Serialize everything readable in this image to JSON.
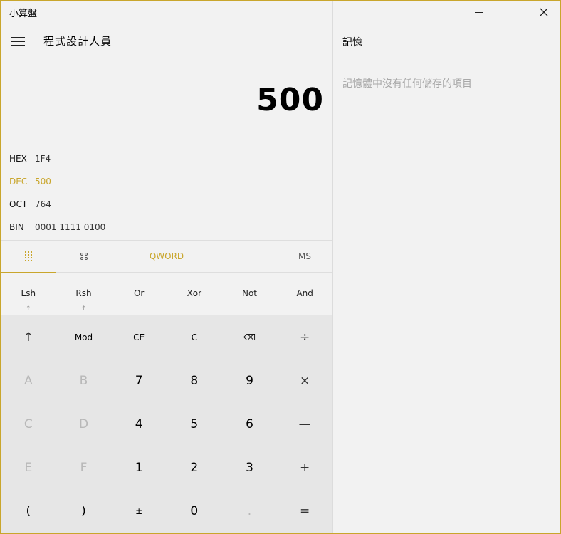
{
  "window": {
    "title": "小算盤",
    "accent": "#c9a62c"
  },
  "header": {
    "mode_title": "程式設計人員"
  },
  "display": {
    "value": "500"
  },
  "radix": [
    {
      "label": "HEX",
      "value": "1F4",
      "active": false
    },
    {
      "label": "DEC",
      "value": "500",
      "active": true
    },
    {
      "label": "OCT",
      "value": "764",
      "active": false
    },
    {
      "label": "BIN",
      "value": "0001 1111 0100",
      "active": false
    }
  ],
  "tabs": {
    "keypad_icon": "full-keypad-icon",
    "bits_icon": "bit-toggling-keypad-icon",
    "word_size": "QWORD",
    "memory_store": "MS"
  },
  "ops": [
    {
      "label": "Lsh",
      "sub": "↑"
    },
    {
      "label": "Rsh",
      "sub": "↑"
    },
    {
      "label": "Or",
      "sub": ""
    },
    {
      "label": "Xor",
      "sub": ""
    },
    {
      "label": "Not",
      "sub": ""
    },
    {
      "label": "And",
      "sub": ""
    }
  ],
  "keys": [
    [
      "↑",
      "Mod",
      "CE",
      "C",
      "⌫",
      "÷"
    ],
    [
      "A",
      "B",
      "7",
      "8",
      "9",
      "×"
    ],
    [
      "C",
      "D",
      "4",
      "5",
      "6",
      "—"
    ],
    [
      "E",
      "F",
      "1",
      "2",
      "3",
      "+"
    ],
    [
      "(",
      ")",
      "±",
      "0",
      ".",
      "="
    ]
  ],
  "memory": {
    "title": "記憶",
    "empty_message": "記憶體中沒有任何儲存的項目"
  }
}
